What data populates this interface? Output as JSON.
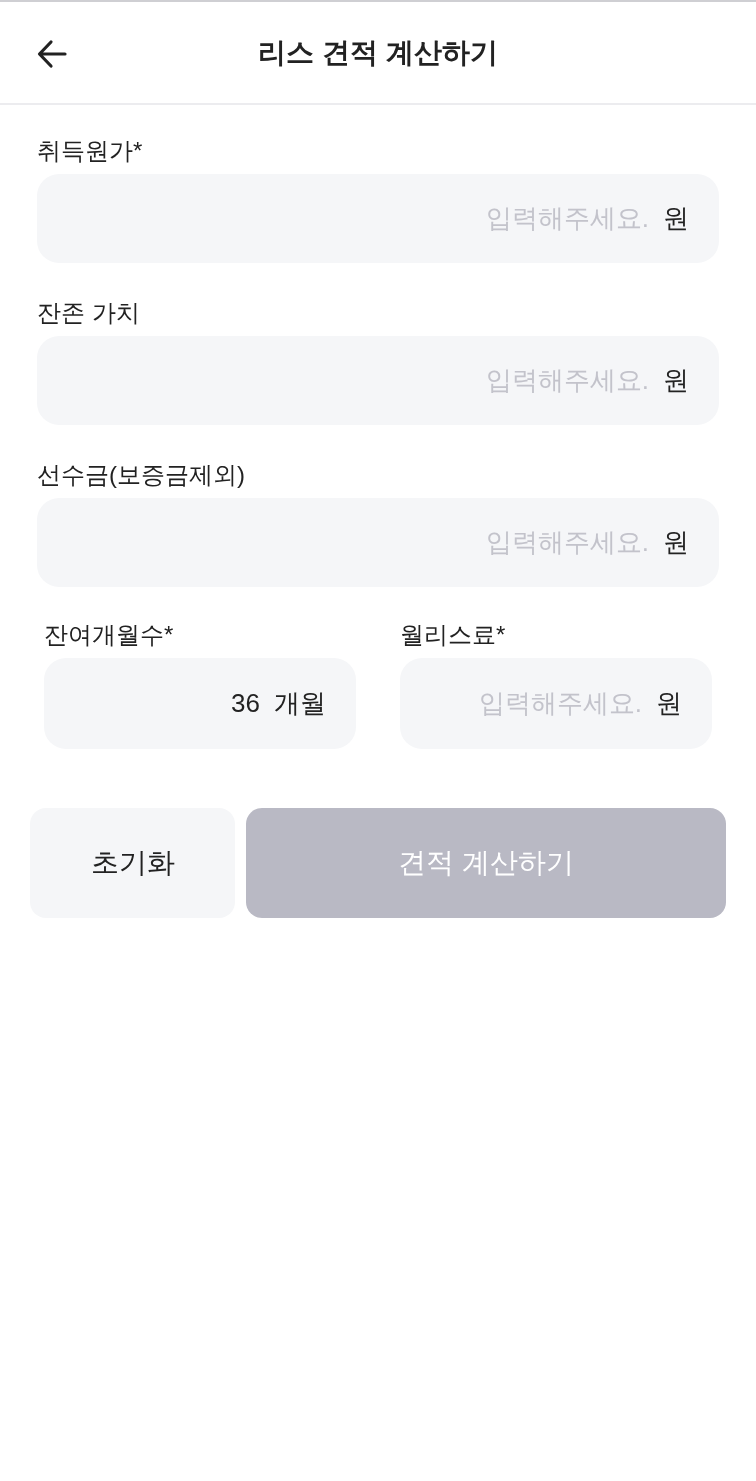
{
  "header": {
    "title": "리스 견적 계산하기"
  },
  "fields": [
    {
      "label": "취득원가*",
      "placeholder": "입력해주세요.",
      "unit": "원"
    },
    {
      "label": "잔존 가치",
      "placeholder": "입력해주세요.",
      "unit": "원"
    },
    {
      "label": "선수금(보증금제외)",
      "placeholder": "입력해주세요.",
      "unit": "원"
    }
  ],
  "row_fields": [
    {
      "label": "잔여개월수*",
      "value": "36",
      "unit": "개월"
    },
    {
      "label": "월리스료*",
      "placeholder": "입력해주세요.",
      "unit": "원"
    }
  ],
  "buttons": [
    {
      "label": "초기화",
      "kind": "secondary",
      "disabled": false
    },
    {
      "label": "견적 계산하기",
      "kind": "primary",
      "disabled": true
    }
  ]
}
